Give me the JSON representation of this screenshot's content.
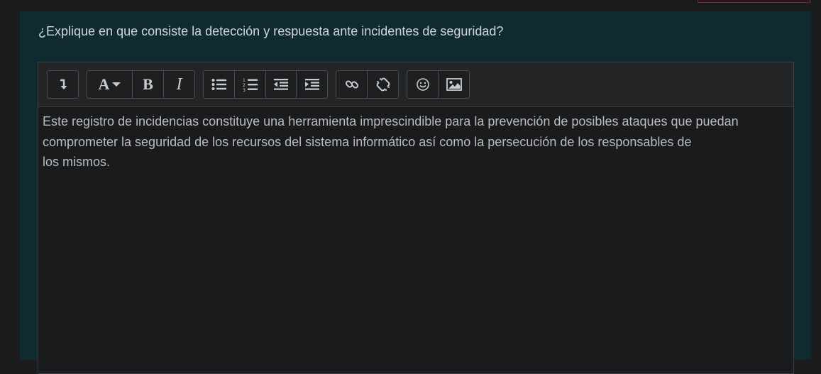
{
  "question": {
    "text": "¿Explique en que consiste la detección y respuesta ante incidentes de seguridad?"
  },
  "toolbar": {
    "groups": [
      [
        "collapse-toolbar-icon"
      ],
      [
        "font-style-dropdown-icon",
        "bold-icon",
        "italic-icon"
      ],
      [
        "unordered-list-icon",
        "ordered-list-icon",
        "outdent-icon",
        "indent-icon"
      ],
      [
        "link-icon",
        "unlink-icon"
      ],
      [
        "emoticon-icon",
        "image-icon"
      ]
    ],
    "bold_glyph": "B",
    "italic_glyph": "I",
    "font_glyph": "A"
  },
  "answer": {
    "lines": [
      "Este registro de incidencias constituye una herramienta imprescindible para la prevención de posibles ataques que puedan",
      "comprometer la seguridad de los recursos del sistema informático así como la persecución de los responsables de",
      "los mismos."
    ]
  },
  "colors": {
    "page_background": "#1b1c1e",
    "panel_background": "#0f2b31",
    "editor_background": "#1a1b1d",
    "toolbar_background": "#222425",
    "text": "#b9bdc0",
    "accent_border": "#8a1f25"
  }
}
